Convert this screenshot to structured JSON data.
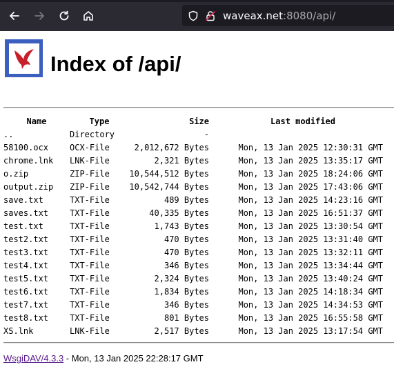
{
  "browser": {
    "url_host": "waveax.net",
    "url_rest": ":8080/api/"
  },
  "page": {
    "title": "Index of /api/",
    "columns": [
      "Name",
      "Type",
      "Size",
      "Last modified"
    ],
    "rows": [
      {
        "name": "..",
        "type": "Directory",
        "size": "-",
        "modified": ""
      },
      {
        "name": "58100.ocx",
        "type": "OCX-File",
        "size": "2,012,672 Bytes",
        "modified": "Mon, 13 Jan 2025 12:30:31 GMT"
      },
      {
        "name": "chrome.lnk",
        "type": "LNK-File",
        "size": "2,321 Bytes",
        "modified": "Mon, 13 Jan 2025 13:35:17 GMT"
      },
      {
        "name": "o.zip",
        "type": "ZIP-File",
        "size": "10,544,512 Bytes",
        "modified": "Mon, 13 Jan 2025 18:24:06 GMT"
      },
      {
        "name": "output.zip",
        "type": "ZIP-File",
        "size": "10,542,744 Bytes",
        "modified": "Mon, 13 Jan 2025 17:43:06 GMT"
      },
      {
        "name": "save.txt",
        "type": "TXT-File",
        "size": "489 Bytes",
        "modified": "Mon, 13 Jan 2025 14:23:16 GMT"
      },
      {
        "name": "saves.txt",
        "type": "TXT-File",
        "size": "40,335 Bytes",
        "modified": "Mon, 13 Jan 2025 16:51:37 GMT"
      },
      {
        "name": "test.txt",
        "type": "TXT-File",
        "size": "1,743 Bytes",
        "modified": "Mon, 13 Jan 2025 13:30:54 GMT"
      },
      {
        "name": "test2.txt",
        "type": "TXT-File",
        "size": "470 Bytes",
        "modified": "Mon, 13 Jan 2025 13:31:40 GMT"
      },
      {
        "name": "test3.txt",
        "type": "TXT-File",
        "size": "470 Bytes",
        "modified": "Mon, 13 Jan 2025 13:32:11 GMT"
      },
      {
        "name": "test4.txt",
        "type": "TXT-File",
        "size": "346 Bytes",
        "modified": "Mon, 13 Jan 2025 13:34:44 GMT"
      },
      {
        "name": "test5.txt",
        "type": "TXT-File",
        "size": "2,324 Bytes",
        "modified": "Mon, 13 Jan 2025 13:40:24 GMT"
      },
      {
        "name": "test6.txt",
        "type": "TXT-File",
        "size": "1,834 Bytes",
        "modified": "Mon, 13 Jan 2025 14:18:34 GMT"
      },
      {
        "name": "test7.txt",
        "type": "TXT-File",
        "size": "346 Bytes",
        "modified": "Mon, 13 Jan 2025 14:34:53 GMT"
      },
      {
        "name": "test8.txt",
        "type": "TXT-File",
        "size": "801 Bytes",
        "modified": "Mon, 13 Jan 2025 16:55:58 GMT"
      },
      {
        "name": "XS.lnk",
        "type": "LNK-File",
        "size": "2,517 Bytes",
        "modified": "Mon, 13 Jan 2025 13:17:54 GMT"
      }
    ],
    "footer_link": "WsgiDAV/4.3.3",
    "footer_text": " - Mon, 13 Jan 2025 22:28:17 GMT"
  },
  "icons": {
    "back": "arrow-left-icon",
    "forward": "arrow-right-icon",
    "reload": "reload-icon",
    "home": "home-icon",
    "tracking": "shield-icon",
    "security": "lock-warning-icon",
    "logo": "bird-logo-icon"
  },
  "colors": {
    "toolbar": "#2b2a33",
    "urlbar": "#1c1b22",
    "logo_bg": "#3a5fbf",
    "logo_bird": "#c8202a",
    "visited_link": "#551a8b"
  }
}
